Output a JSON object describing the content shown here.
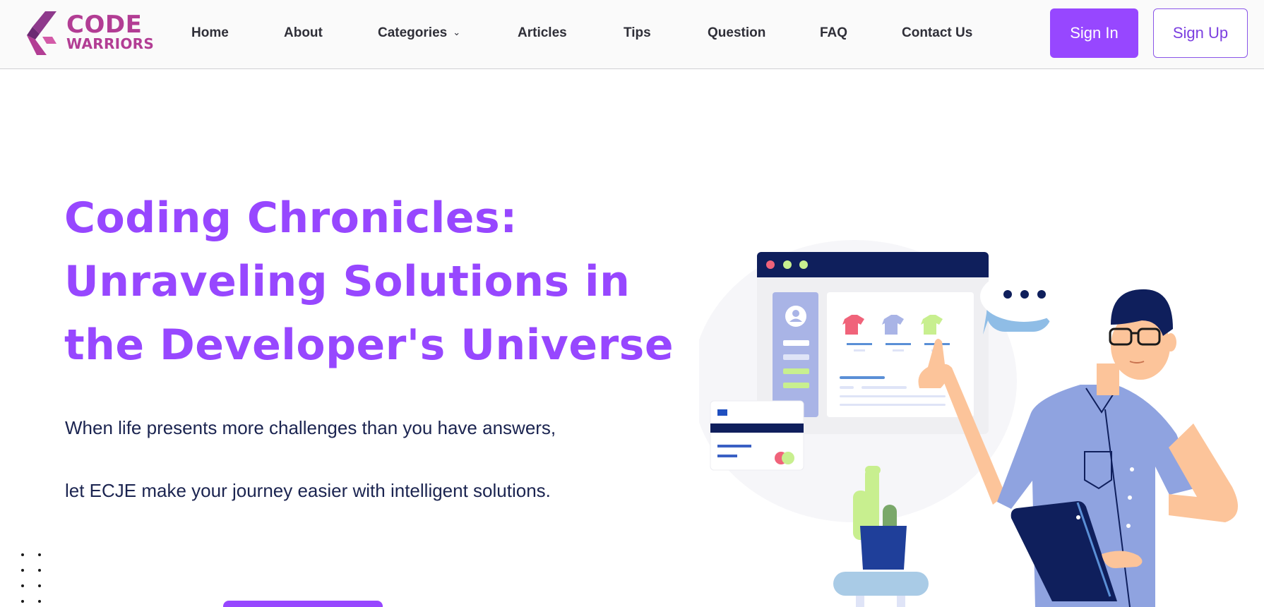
{
  "brand": {
    "line1": "CODE",
    "line2": "WARRIORS",
    "color": "#b23d94"
  },
  "nav": {
    "items": [
      {
        "label": "Home"
      },
      {
        "label": "About"
      },
      {
        "label": "Categories",
        "icon": "chevron-down-icon"
      },
      {
        "label": "Articles"
      },
      {
        "label": "Tips"
      },
      {
        "label": "Question"
      },
      {
        "label": "FAQ"
      },
      {
        "label": "Contact Us"
      }
    ]
  },
  "auth": {
    "sign_in": "Sign In",
    "sign_up": "Sign Up"
  },
  "hero": {
    "title_lines": [
      "Coding Chronicles:",
      "Unraveling Solutions in",
      "the Developer's Universe"
    ],
    "subtitle_lines": [
      "When life presents more challenges than you have answers,",
      "let ECJE make your journey easier with intelligent solutions."
    ]
  },
  "colors": {
    "accent": "#9747ff",
    "text_dark": "#1b2450",
    "navy": "#0f1f5c"
  }
}
